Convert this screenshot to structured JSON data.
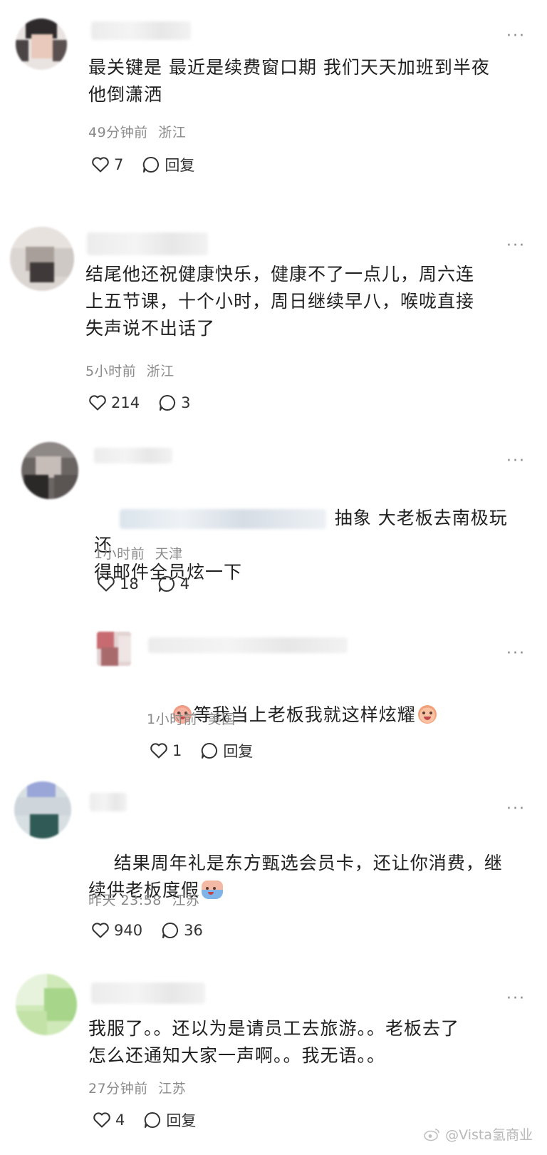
{
  "comments": [
    {
      "more": "···",
      "text": "最关键是 最近是续费窗口期 我们天天加班到半夜\n他倒潇洒",
      "time": "49分钟前",
      "location": "浙江",
      "likes": "7",
      "reply_label": "回复"
    },
    {
      "more": "···",
      "text": "结尾他还祝健康快乐，健康不了一点儿，周六连\n上五节课，十个小时，周日继续早八，喉咙直接\n失声说不出话了",
      "time": "5小时前",
      "location": "浙江",
      "likes": "214",
      "replies": "3"
    },
    {
      "more": "···",
      "text_line1": "抽象 大老板去南极玩还",
      "text_line2": "得邮件全员炫一下",
      "time": "1小时前",
      "location": "天津",
      "likes": "18",
      "replies": "4"
    },
    {
      "more": "···",
      "text": "等我当上老板我就这样炫耀",
      "time": "1小时前",
      "location": "美国",
      "likes": "1",
      "reply_label": "回复"
    },
    {
      "more": "···",
      "text_line1": "结果周年礼是东方甄选会员卡，还让你消费，继",
      "text_line2": "续供老板度假",
      "time": "昨天 23:58",
      "location": "江苏",
      "likes": "940",
      "replies": "36"
    },
    {
      "more": "···",
      "text": "我服了。。还以为是请员工去旅游。。老板去了\n怎么还通知大家一声啊。。我无语。。",
      "time": "27分钟前",
      "location": "江苏",
      "likes": "4",
      "reply_label": "回复"
    }
  ],
  "watermark": "@Vista氢商业",
  "icons": {
    "like": "heart-outline-icon",
    "comment": "speech-bubble-icon",
    "more": "more-dots-icon",
    "weibo": "weibo-logo-icon"
  }
}
